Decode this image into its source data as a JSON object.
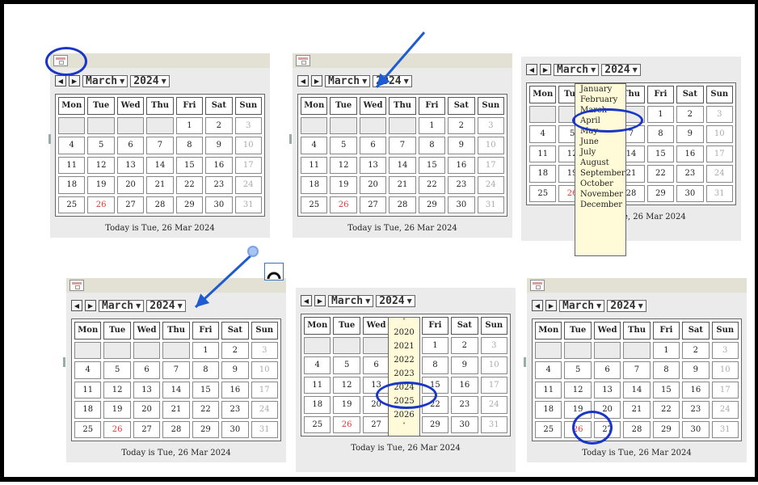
{
  "colors": {
    "accent": "#1a36c8",
    "today": "#e23a3a",
    "widget_bg": "#ebebeb",
    "dropdown_bg": "#fffbd8"
  },
  "calendar": {
    "prev_label": "◀",
    "next_label": "▶",
    "month": "March",
    "year": "2024",
    "weekdays": [
      "Mon",
      "Tue",
      "Wed",
      "Thu",
      "Fri",
      "Sat",
      "Sun"
    ],
    "days": [
      "",
      "",
      "",
      "",
      "1",
      "2",
      "3",
      "4",
      "5",
      "6",
      "7",
      "8",
      "9",
      "10",
      "11",
      "12",
      "13",
      "14",
      "15",
      "16",
      "17",
      "18",
      "19",
      "20",
      "21",
      "22",
      "23",
      "24",
      "25",
      "26",
      "27",
      "28",
      "29",
      "30",
      "31"
    ],
    "today_day": "26",
    "footer": "Today is Tue, 26 Mar 2024"
  },
  "month_dropdown": {
    "options": [
      "January",
      "February",
      "March",
      "April",
      "May",
      "June",
      "July",
      "August",
      "September",
      "October",
      "November",
      "December"
    ],
    "selected": "March"
  },
  "year_dropdown": {
    "up": "˄",
    "options": [
      "2020",
      "2021",
      "2022",
      "2023",
      "2024",
      "2025",
      "2026"
    ],
    "down": "˅",
    "selected": "2024"
  }
}
